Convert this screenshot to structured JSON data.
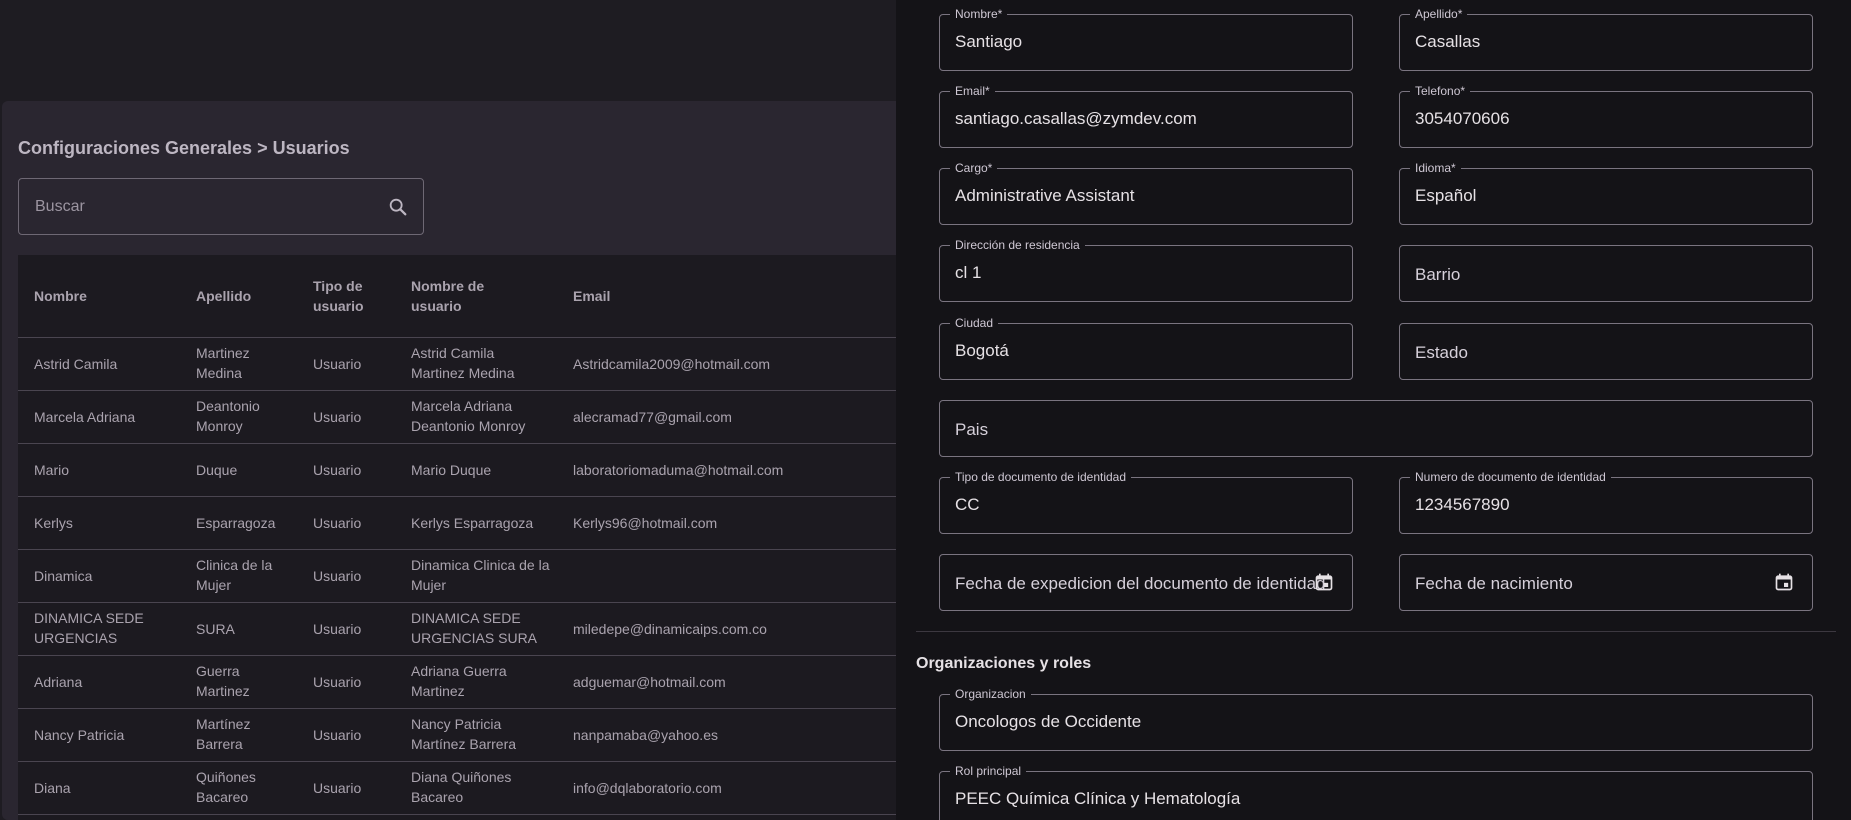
{
  "breadcrumb": "Configuraciones Generales > Usuarios",
  "search": {
    "placeholder": "Buscar"
  },
  "table": {
    "headers": [
      "Nombre",
      "Apellido",
      "Tipo de usuario",
      "Nombre de usuario",
      "Email"
    ],
    "rows": [
      [
        "Astrid Camila",
        "Martinez Medina",
        "Usuario",
        "Astrid Camila Martinez Medina",
        "Astridcamila2009@hotmail.com"
      ],
      [
        "Marcela Adriana",
        "Deantonio Monroy",
        "Usuario",
        "Marcela Adriana Deantonio Monroy",
        "alecramad77@gmail.com"
      ],
      [
        "Mario",
        "Duque",
        "Usuario",
        "Mario Duque",
        "laboratoriomaduma@hotmail.com"
      ],
      [
        "Kerlys",
        "Esparragoza",
        "Usuario",
        "Kerlys Esparragoza",
        "Kerlys96@hotmail.com"
      ],
      [
        "Dinamica",
        "Clinica de la Mujer",
        "Usuario",
        "Dinamica Clinica de la Mujer",
        ""
      ],
      [
        "DINAMICA SEDE URGENCIAS",
        "SURA",
        "Usuario",
        "DINAMICA SEDE URGENCIAS SURA",
        "miledepe@dinamicaips.com.co"
      ],
      [
        "Adriana",
        "Guerra Martinez",
        "Usuario",
        "Adriana Guerra Martinez",
        "adguemar@hotmail.com"
      ],
      [
        "Nancy Patricia",
        "Martínez Barrera",
        "Usuario",
        "Nancy Patricia Martínez Barrera",
        "nanpamaba@yahoo.es"
      ],
      [
        "Diana",
        "Quiñones Bacareo",
        "Usuario",
        "Diana Quiñones Bacareo",
        "info@dqlaboratorio.com"
      ]
    ]
  },
  "form": {
    "nombre": {
      "label": "Nombre*",
      "value": "Santiago"
    },
    "apellido": {
      "label": "Apellido*",
      "value": "Casallas"
    },
    "email": {
      "label": "Email*",
      "value": "santiago.casallas@zymdev.com"
    },
    "telefono": {
      "label": "Telefono*",
      "value": "3054070606"
    },
    "cargo": {
      "label": "Cargo*",
      "value": "Administrative Assistant"
    },
    "idioma": {
      "label": "Idioma*",
      "value": "Español"
    },
    "direccion": {
      "label": "Dirección de residencia",
      "value": "cl 1"
    },
    "barrio": {
      "placeholder": "Barrio"
    },
    "ciudad": {
      "label": "Ciudad",
      "value": "Bogotá"
    },
    "estado": {
      "placeholder": "Estado"
    },
    "pais": {
      "placeholder": "Pais"
    },
    "tipo_doc": {
      "label": "Tipo de documento de identidad",
      "value": "CC"
    },
    "num_doc": {
      "label": "Numero de documento de identidad",
      "value": "1234567890"
    },
    "fecha_exp": {
      "placeholder": "Fecha de expedicion del documento de identidad"
    },
    "fecha_nac": {
      "placeholder": "Fecha de nacimiento"
    },
    "section_title": "Organizaciones y roles",
    "organizacion": {
      "label": "Organizacion",
      "value": "Oncologos de Occidente"
    },
    "rol": {
      "label": "Rol principal",
      "value": "PEEC Química Clínica y Hematología"
    }
  },
  "icons": {
    "search": "search-icon",
    "calendar": "calendar-icon"
  },
  "colors": {
    "background": "#1e1c22",
    "drawer": "#141317",
    "card": "#2a2630"
  }
}
